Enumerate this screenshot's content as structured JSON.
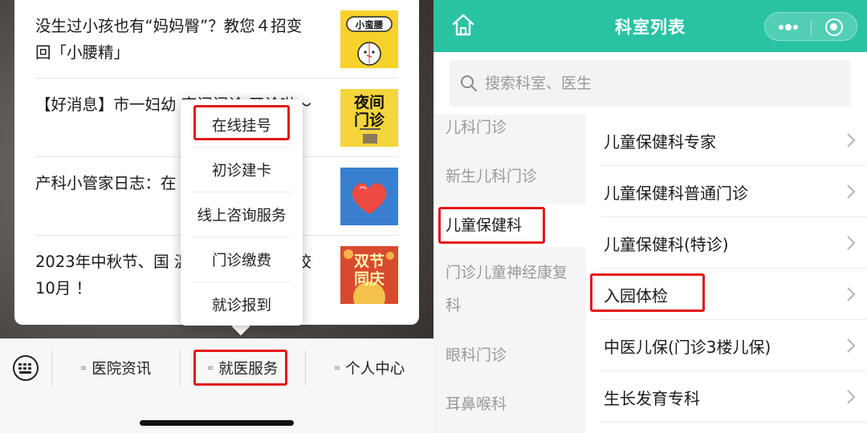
{
  "articles": [
    {
      "title": "没生过小孩也有“妈妈臀”？教您４招变回「小腰精」",
      "thumb_text": "小蛮腰"
    },
    {
      "title": "【好消息】市一妇幼 夜间门诊 开诊啦～",
      "thumb_text": "夜间门诊"
    },
    {
      "title": "产科小管家日志：在 温暖着彼此",
      "thumb_text": ""
    },
    {
      "title": "2023年中秋节、国 温馨提示&孕妇学校10月 ！",
      "thumb_text": "双节同庆"
    }
  ],
  "popup_menu": {
    "items": [
      "在线挂号",
      "初诊建卡",
      "线上咨询服务",
      "门诊缴费",
      "就诊报到"
    ],
    "highlighted": "在线挂号"
  },
  "tabbar": {
    "tabs": [
      "医院资讯",
      "就医服务",
      "个人中心"
    ],
    "active": "就医服务"
  },
  "right": {
    "nav_title": "科室列表",
    "search_placeholder": "搜索科室、医生",
    "departments": [
      "儿科门诊",
      "新生儿科门诊",
      "儿童保健科",
      "门诊儿童神经康复科",
      "眼科门诊",
      "耳鼻喉科"
    ],
    "selected_department": "儿童保健科",
    "sub_items": [
      "儿童保健科专家",
      "儿童保健科普通门诊",
      "儿童保健科(特诊)",
      "入园体检",
      "中医儿保(门诊3楼儿保)",
      "生长发育专科"
    ],
    "highlighted_sub_item": "入园体检"
  },
  "colors": {
    "nav_green": "#29c3a4",
    "highlight_red": "#e21818"
  }
}
